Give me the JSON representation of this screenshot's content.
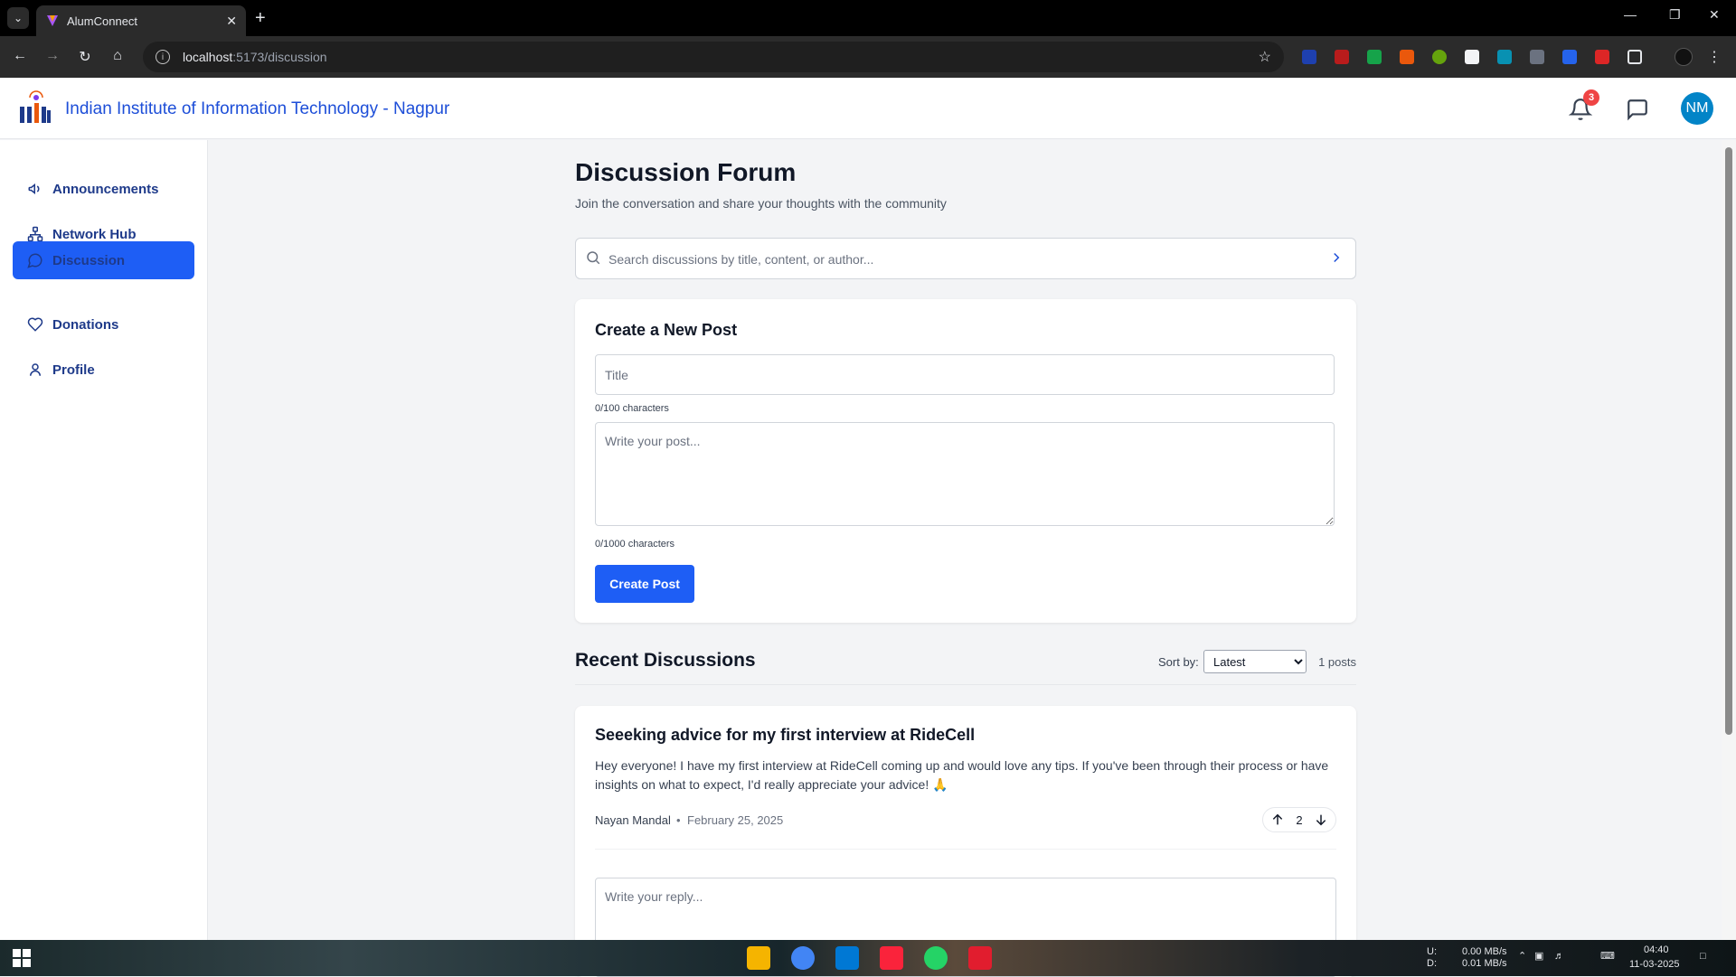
{
  "browser": {
    "tab_title": "AlumConnect",
    "url_host": "localhost",
    "url_path": ":5173/discussion"
  },
  "header": {
    "institute_name": "Indian Institute of Information Technology - Nagpur",
    "notification_count": "3",
    "avatar_initials": "NM"
  },
  "sidebar": {
    "items": [
      {
        "label": "Announcements",
        "icon": "megaphone-icon"
      },
      {
        "label": "Network Hub",
        "icon": "network-icon"
      },
      {
        "label": "Discussion",
        "icon": "chat-bubble-icon",
        "active": true
      },
      {
        "label": "Donations",
        "icon": "heart-icon"
      },
      {
        "label": "Profile",
        "icon": "user-icon"
      }
    ]
  },
  "page": {
    "title": "Discussion Forum",
    "subtitle": "Join the conversation and share your thoughts with the community"
  },
  "search": {
    "placeholder": "Search discussions by title, content, or author..."
  },
  "create_post": {
    "heading": "Create a New Post",
    "title_placeholder": "Title",
    "title_counter": "0/100 characters",
    "body_placeholder": "Write your post...",
    "body_counter": "0/1000 characters",
    "button_label": "Create Post"
  },
  "recent": {
    "heading": "Recent Discussions",
    "sort_label": "Sort by:",
    "sort_value": "Latest",
    "post_count": "1 posts"
  },
  "posts": [
    {
      "title": "Seeeking advice for my first interview at RideCell",
      "body": "Hey everyone! I have my first interview at RideCell coming up and would love any tips. If you've been through their process or have insights on what to expect, I'd really appreciate your advice! 🙏",
      "author": "Nayan Mandal",
      "separator": "•",
      "date": "February 25, 2025",
      "votes": "2",
      "reply_placeholder": "Write your reply..."
    }
  ],
  "taskbar": {
    "net_up_label": "U:",
    "net_down_label": "D:",
    "net_up": "0.00 MB/s",
    "net_down": "0.01 MB/s",
    "time": "04:40",
    "date": "11-03-2025"
  },
  "colors": {
    "accent": "#1e5ef5",
    "brand_text": "#1d4ed8",
    "avatar": "#0284c7",
    "badge": "#ef4444"
  }
}
